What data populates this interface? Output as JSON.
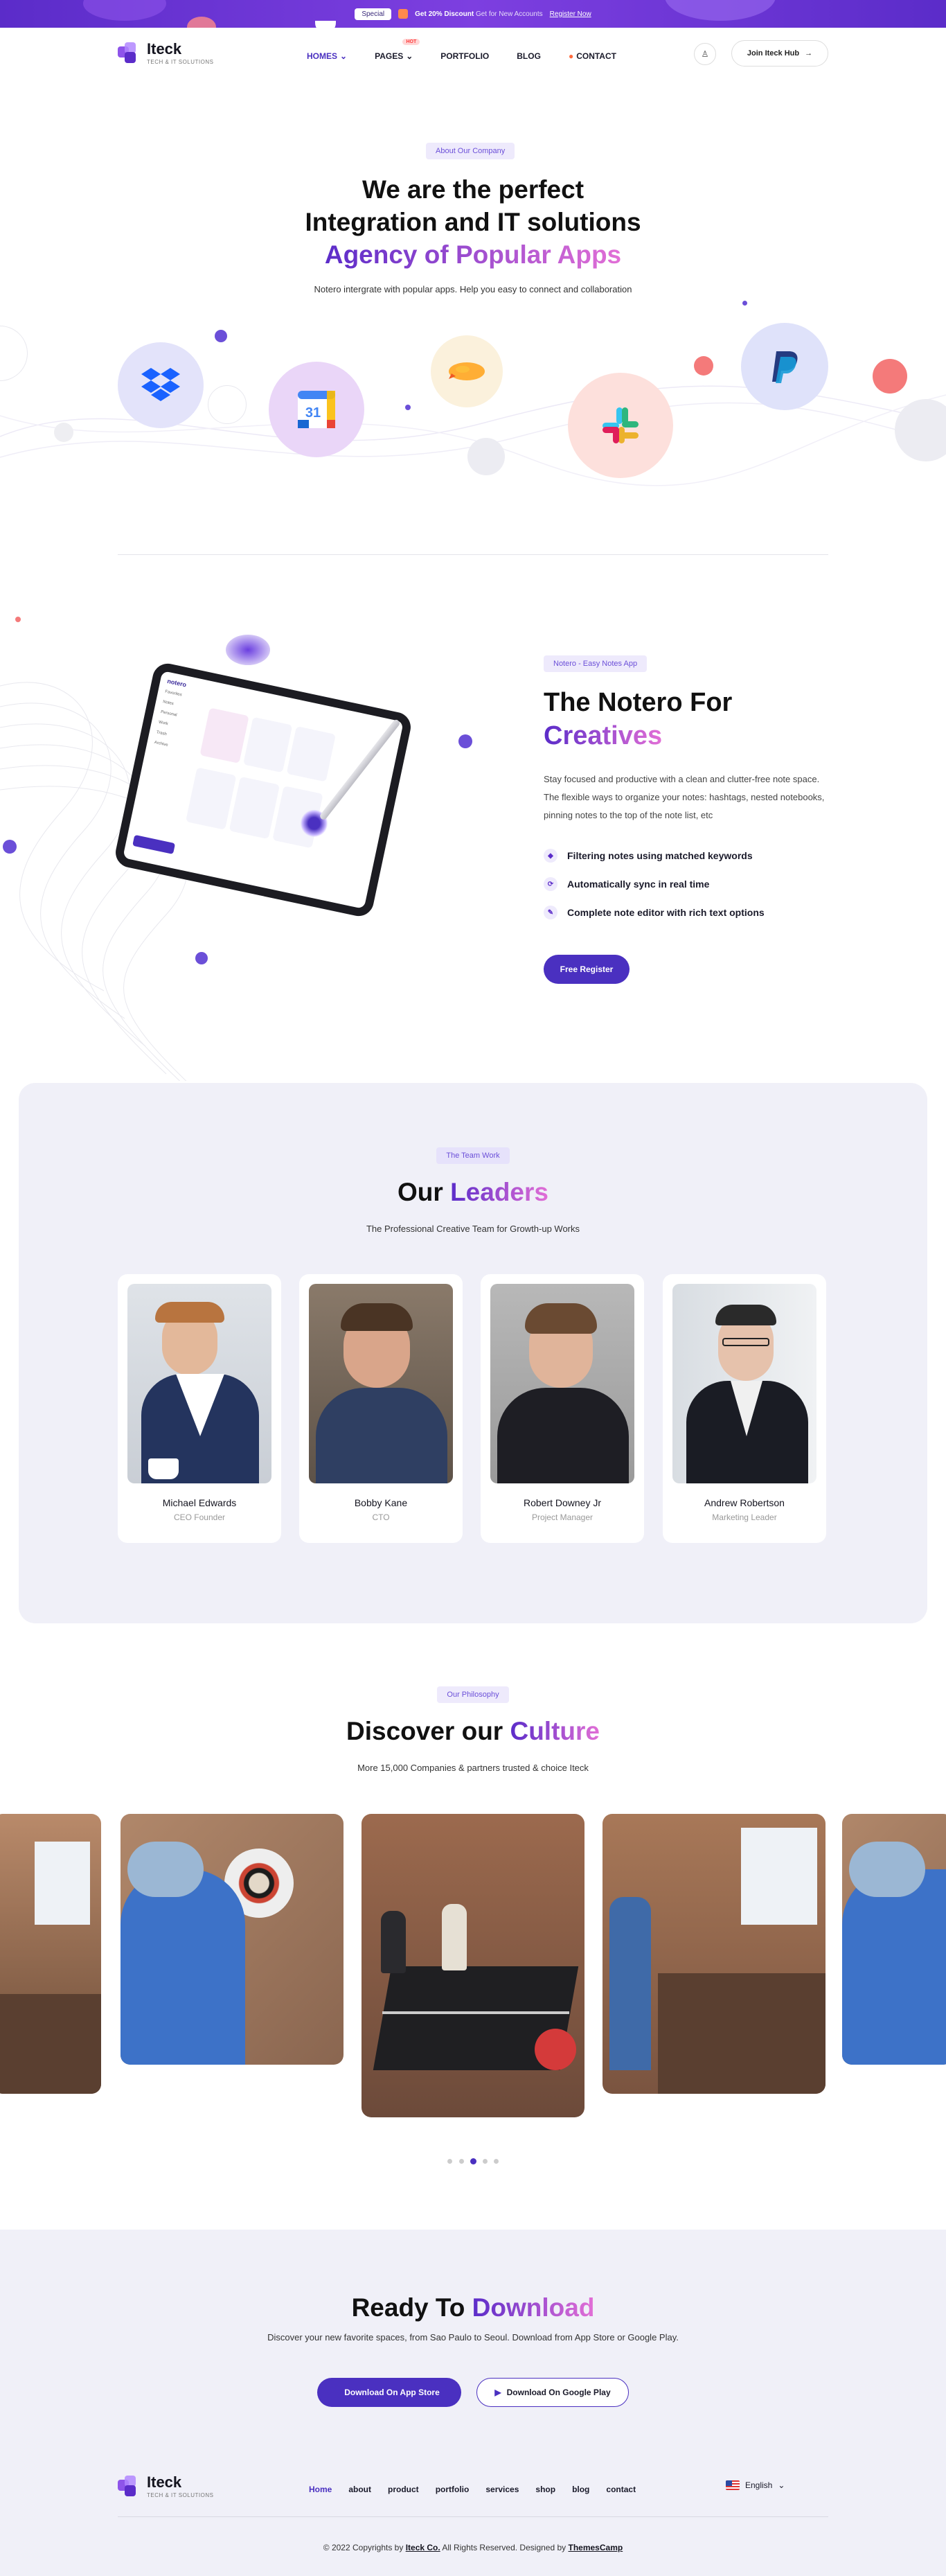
{
  "promo": {
    "special_label": "Special",
    "discount_text": "Get 20% Discount",
    "audience_text": "Get for New Accounts",
    "cta": "Register Now"
  },
  "brand": {
    "name": "Iteck",
    "tagline": "TECH & IT SOLUTIONS"
  },
  "nav": {
    "items": [
      {
        "label": "HOMES",
        "active": true,
        "dropdown": true
      },
      {
        "label": "PAGES",
        "active": false,
        "dropdown": true,
        "badge": "HOT"
      },
      {
        "label": "PORTFOLIO",
        "active": false
      },
      {
        "label": "BLOG",
        "active": false
      },
      {
        "label": "CONTACT",
        "active": false
      }
    ],
    "join_label": "Join Iteck Hub"
  },
  "about": {
    "badge": "About Our Company",
    "title_line1": "We are the perfect",
    "title_line2": "Integration and IT solutions",
    "title_highlight": "Agency of Popular Apps",
    "subtitle": "Notero intergrate with popular apps. Help you easy to connect and collaboration",
    "apps": [
      "dropbox-icon",
      "google-calendar-icon",
      "zeplin-icon",
      "slack-icon",
      "paypal-icon"
    ]
  },
  "notero": {
    "badge": "Notero - Easy Notes App",
    "title_line1": "The Notero For",
    "title_highlight": "Creatives",
    "description": "Stay focused and productive with a clean and clutter-free note space. The flexible ways to organize your notes: hashtags, nested notebooks, pinning notes to the top of the note list, etc",
    "features": [
      {
        "icon": "tag-icon",
        "label": "Filtering notes using matched keywords"
      },
      {
        "icon": "sync-icon",
        "label": "Automatically sync in real time"
      },
      {
        "icon": "editor-icon",
        "label": "Complete note editor with rich text options"
      }
    ],
    "cta": "Free Register",
    "tablet": {
      "brand": "notero",
      "sidebar": [
        "Favorites",
        "Notes",
        "Personal",
        "Work",
        "Trash",
        "Archive"
      ]
    }
  },
  "leaders": {
    "badge": "The Team Work",
    "title_plain": "Our",
    "title_highlight": "Leaders",
    "subtitle": "The Professional Creative Team for Growth-up Works",
    "members": [
      {
        "name": "Michael Edwards",
        "role": "CEO Founder"
      },
      {
        "name": "Bobby Kane",
        "role": "CTO"
      },
      {
        "name": "Robert Downey Jr",
        "role": "Project Manager"
      },
      {
        "name": "Andrew Robertson",
        "role": "Marketing Leader"
      }
    ]
  },
  "culture": {
    "badge": "Our Philosophy",
    "title_plain": "Discover our",
    "title_highlight": "Culture",
    "subtitle": "More 15,000 Companies & partners trusted & choice Iteck",
    "active_dot": 3,
    "dot_count": 5
  },
  "download": {
    "title_plain": "Ready To",
    "title_highlight": "Download",
    "subtitle": "Discover your new favorite spaces, from Sao Paulo to Seoul. Download from App Store or Google Play.",
    "app_store": "Download On App Store",
    "google_play": "Download On Google Play"
  },
  "footer": {
    "links": [
      {
        "label": "Home",
        "active": true
      },
      {
        "label": "about"
      },
      {
        "label": "product"
      },
      {
        "label": "portfolio"
      },
      {
        "label": "services"
      },
      {
        "label": "shop"
      },
      {
        "label": "blog"
      },
      {
        "label": "contact"
      }
    ],
    "language": "English",
    "copyright_prefix": "© 2022 Copyrights by",
    "copyright_company": "Iteck Co.",
    "copyright_middle": "All Rights Reserved. Designed by",
    "copyright_designer": "ThemesCamp"
  },
  "colors": {
    "accent": "#4a30c0",
    "accent_light": "#eeeafc",
    "section_bg": "#f0f0f8"
  }
}
